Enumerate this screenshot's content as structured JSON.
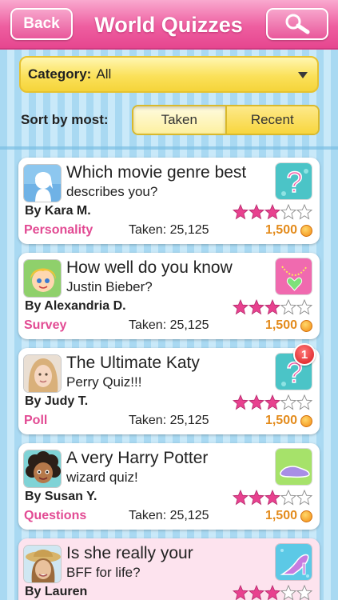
{
  "header": {
    "back_label": "Back",
    "title": "World Quizzes",
    "search_icon": "magnifier-icon"
  },
  "filter": {
    "category_label": "Category:",
    "category_value": "All"
  },
  "sort": {
    "label": "Sort by most:",
    "options": [
      "Taken",
      "Recent"
    ],
    "selected": "Taken"
  },
  "colors": {
    "header_pink": "#ee5ea0",
    "category_pink": "#e24a93",
    "points_orange": "#e38b1c",
    "dropdown_yellow": "#fbe15a"
  },
  "quizzes": [
    {
      "title_line1": "Which movie genre best",
      "title_line2": "describes you?",
      "author": "By Kara M.",
      "category": "Personality",
      "taken": "Taken: 25,125",
      "points": "1,500",
      "rating": 3,
      "avatar": "silhouette-avatar",
      "thumb": "question-mark-icon"
    },
    {
      "title_line1": "How well do you know",
      "title_line2": "Justin Bieber?",
      "author": "By Alexandria D.",
      "category": "Survey",
      "taken": "Taken: 25,125",
      "points": "1,500",
      "rating": 3,
      "avatar": "cartoon-girl-avatar",
      "thumb": "heart-necklace-icon"
    },
    {
      "title_line1": "The Ultimate Katy",
      "title_line2": "Perry Quiz!!!",
      "author": "By Judy T.",
      "category": "Poll",
      "taken": "Taken: 25,125",
      "points": "1,500",
      "rating": 3,
      "avatar": "photo-girl-avatar",
      "thumb": "question-mark-icon",
      "badge": "1"
    },
    {
      "title_line1": "A very Harry Potter",
      "title_line2": "wizard quiz!",
      "author": "By Susan Y.",
      "category": "Questions",
      "taken": "Taken: 25,125",
      "points": "1,500",
      "rating": 3,
      "avatar": "cartoon-curly-girl-avatar",
      "thumb": "shoe-icon"
    },
    {
      "title_line1": "Is she really your",
      "title_line2": "BFF for life?",
      "author": "By Lauren",
      "rating": 3,
      "avatar": "photo-hat-girl-avatar",
      "thumb": "high-heel-icon"
    }
  ]
}
